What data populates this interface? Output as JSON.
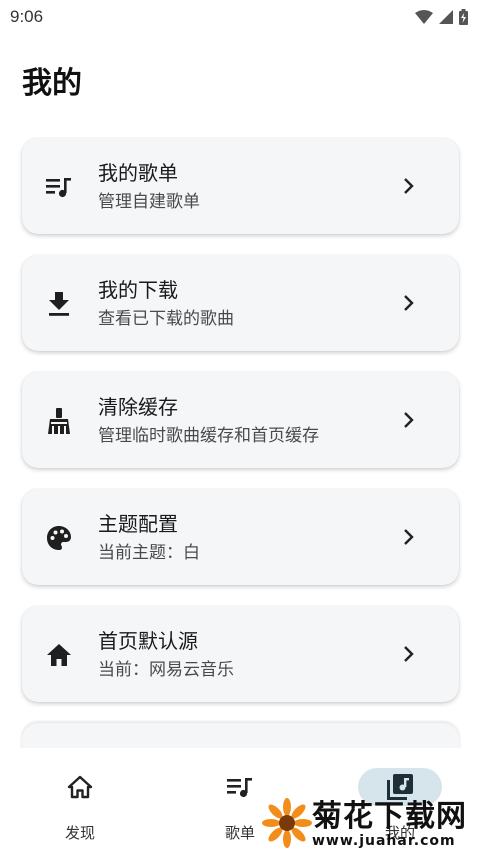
{
  "status_bar": {
    "time": "9:06"
  },
  "page": {
    "title": "我的"
  },
  "menu": [
    {
      "label": "我的歌单",
      "sub": "管理自建歌单",
      "icon": "playlist-icon"
    },
    {
      "label": "我的下载",
      "sub": "查看已下载的歌曲",
      "icon": "download-icon"
    },
    {
      "label": "清除缓存",
      "sub": "管理临时歌曲缓存和首页缓存",
      "icon": "broom-icon"
    },
    {
      "label": "主题配置",
      "sub": "当前主题：白",
      "icon": "palette-icon"
    },
    {
      "label": "首页默认源",
      "sub": "当前：网易云音乐",
      "icon": "home-icon"
    }
  ],
  "nav": [
    {
      "label": "发现",
      "icon": "home-outline-icon",
      "active": false
    },
    {
      "label": "歌单",
      "icon": "playlist-icon",
      "active": false
    },
    {
      "label": "我的",
      "icon": "library-music-icon",
      "active": true
    }
  ],
  "watermark": {
    "title": "菊花下载网",
    "url": "www.juahar.com"
  },
  "colors": {
    "card_bg": "#f4f6f8",
    "active_nav_bg": "#d6e4ec",
    "icon": "#1f1f1f"
  }
}
